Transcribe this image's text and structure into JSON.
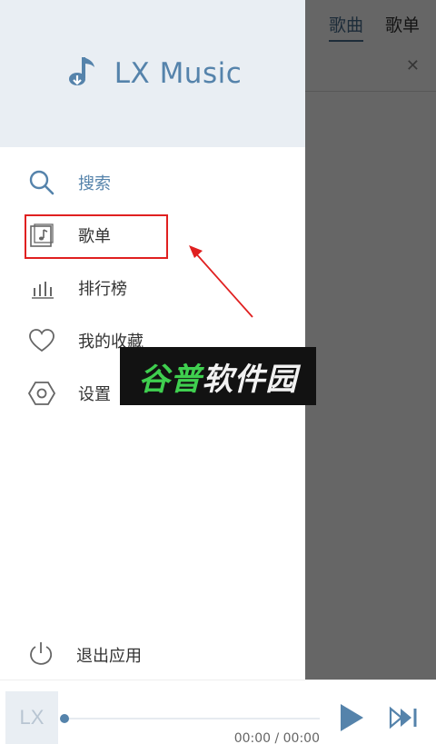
{
  "app": {
    "title": "LX Music"
  },
  "background": {
    "tabs": [
      {
        "label": "歌曲",
        "active": true
      },
      {
        "label": "歌单",
        "active": false
      }
    ]
  },
  "drawer": {
    "menu": [
      {
        "label": "搜索",
        "icon": "search-icon"
      },
      {
        "label": "歌单",
        "icon": "playlist-icon"
      },
      {
        "label": "排行榜",
        "icon": "leaderboard-icon"
      },
      {
        "label": "我的收藏",
        "icon": "heart-icon"
      },
      {
        "label": "设置",
        "icon": "settings-icon"
      }
    ],
    "exit": {
      "label": "退出应用",
      "icon": "power-icon"
    }
  },
  "watermark": {
    "part1": "谷普",
    "part2": "软件园"
  },
  "player": {
    "logo": "LX",
    "time": "00:00 / 00:00",
    "progress": 0
  },
  "colors": {
    "accent": "#5583ab",
    "header_bg": "#e9eef3",
    "highlight": "#e02020"
  }
}
